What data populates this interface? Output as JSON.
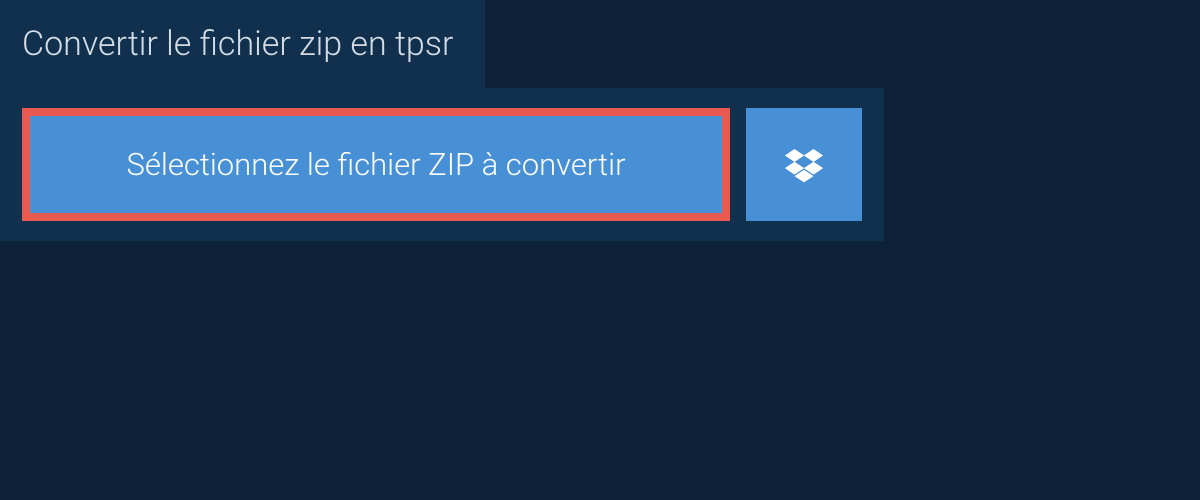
{
  "header": {
    "title": "Convertir le fichier zip en tpsr"
  },
  "actions": {
    "select_file_label": "Sélectionnez le fichier ZIP à convertir"
  },
  "colors": {
    "background": "#0d2238",
    "panel": "#10304e",
    "button_primary": "#4790d5",
    "button_highlight_border": "#e85a4f"
  }
}
